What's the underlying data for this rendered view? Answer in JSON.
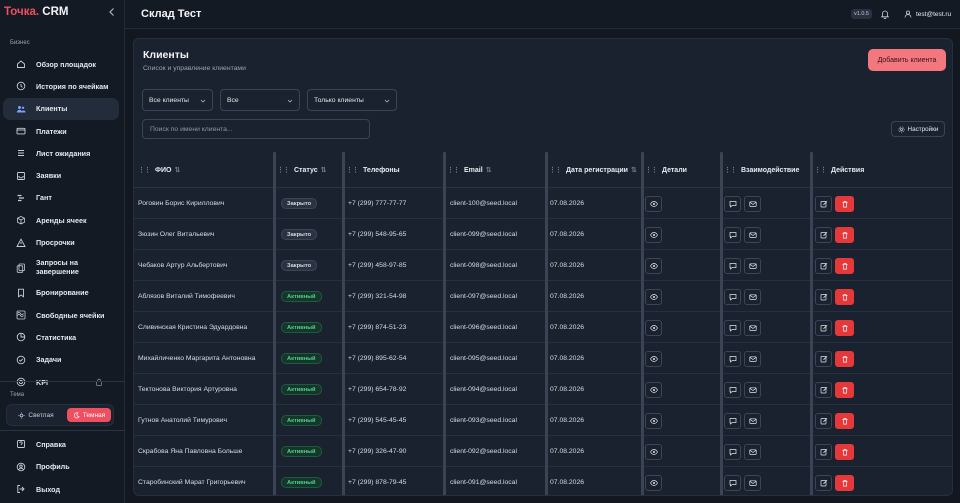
{
  "brand": {
    "name": "Точка.",
    "suffix": " CRM"
  },
  "sidebar": {
    "section_business": "Бизнес",
    "items": [
      {
        "label": "Обзор площадок",
        "icon": "home-icon"
      },
      {
        "label": "История по ячейкам",
        "icon": "clock-icon"
      },
      {
        "label": "Клиенты",
        "icon": "users-icon",
        "active": true
      },
      {
        "label": "Платежи",
        "icon": "card-icon"
      },
      {
        "label": "Лист ожидания",
        "icon": "list-icon"
      },
      {
        "label": "Заявки",
        "icon": "inbox-icon"
      },
      {
        "label": "Гант",
        "icon": "gantt-icon"
      },
      {
        "label": "Аренды ячеек",
        "icon": "box-icon"
      },
      {
        "label": "Просрочки",
        "icon": "warning-icon"
      },
      {
        "label": "Запросы на завершение",
        "icon": "copy-icon"
      },
      {
        "label": "Бронирование",
        "icon": "bookmark-icon"
      },
      {
        "label": "Свободные ячейки",
        "icon": "grid-icon"
      },
      {
        "label": "Статистика",
        "icon": "chart-icon"
      },
      {
        "label": "Задачи",
        "icon": "check-circle-icon"
      },
      {
        "label": "KPI",
        "icon": "target-icon",
        "locked": true
      }
    ],
    "section_theme": "Тема",
    "theme_light": "Светлая",
    "theme_dark": "Темная",
    "bottom": [
      {
        "label": "Справка",
        "icon": "help-icon"
      },
      {
        "label": "Профиль",
        "icon": "profile-icon"
      },
      {
        "label": "Выход",
        "icon": "logout-icon"
      }
    ]
  },
  "topbar": {
    "title": "Склад Тест",
    "version": "v1.0.5",
    "user_email": "test@test.ru"
  },
  "page": {
    "title": "Клиенты",
    "subtitle": "Список и управление клиентами",
    "add_button": "Добавить клиента",
    "filters": [
      "Все клиенты",
      "Все",
      "Только клиенты"
    ],
    "search_placeholder": "Поиск по имени клиента...",
    "settings_button": "Настройки"
  },
  "table": {
    "columns": [
      "ФИО",
      "Статус",
      "Телефоны",
      "Email",
      "Дата регистрации",
      "Детали",
      "Взаимодействие",
      "Действия"
    ],
    "rows": [
      {
        "name": "Роговин Борис Кириллович",
        "status": "Закрыто",
        "status_type": "closed",
        "phone": "+7 (299) 777-77-77",
        "email": "client-100@seed.local",
        "date": "07.08.2026"
      },
      {
        "name": "Зюзин Олег Витальевич",
        "status": "Закрыто",
        "status_type": "closed",
        "phone": "+7 (299) 548-95-65",
        "email": "client-099@seed.local",
        "date": "07.08.2026"
      },
      {
        "name": "Чебаков Артур Альбертович",
        "status": "Закрыто",
        "status_type": "closed",
        "phone": "+7 (299) 458-97-85",
        "email": "client-098@seed.local",
        "date": "07.08.2026"
      },
      {
        "name": "Аблязов Виталий Тимофеевич",
        "status": "Активный",
        "status_type": "active",
        "phone": "+7 (299) 321-54-98",
        "email": "client-097@seed.local",
        "date": "07.08.2026"
      },
      {
        "name": "Сливинская Кристина Эдуардовна",
        "status": "Активный",
        "status_type": "active",
        "phone": "+7 (299) 874-51-23",
        "email": "client-096@seed.local",
        "date": "07.08.2026"
      },
      {
        "name": "Михайличенко Маргарита Антоновна",
        "status": "Активный",
        "status_type": "active",
        "phone": "+7 (299) 895-62-54",
        "email": "client-095@seed.local",
        "date": "07.08.2026"
      },
      {
        "name": "Тектонова Виктория Артуровна",
        "status": "Активный",
        "status_type": "active",
        "phone": "+7 (299) 654-78-92",
        "email": "client-094@seed.local",
        "date": "07.08.2026"
      },
      {
        "name": "Гутнов Анатолий Тимурович",
        "status": "Активный",
        "status_type": "active",
        "phone": "+7 (299) 545-45-45",
        "email": "client-093@seed.local",
        "date": "07.08.2026"
      },
      {
        "name": "Скрабова Яна Павловна Больше",
        "status": "Активный",
        "status_type": "active",
        "phone": "+7 (299) 326-47-90",
        "email": "client-092@seed.local",
        "date": "07.08.2026"
      },
      {
        "name": "Старобинский Марат Григорьевич",
        "status": "Активный",
        "status_type": "active",
        "phone": "+7 (299) 878-79-45",
        "email": "client-091@seed.local",
        "date": "07.08.2026"
      }
    ]
  },
  "colors": {
    "accent": "#ef4f5f",
    "active_badge": "#4fd08b",
    "delete": "#e5383b",
    "background": "#121720"
  }
}
